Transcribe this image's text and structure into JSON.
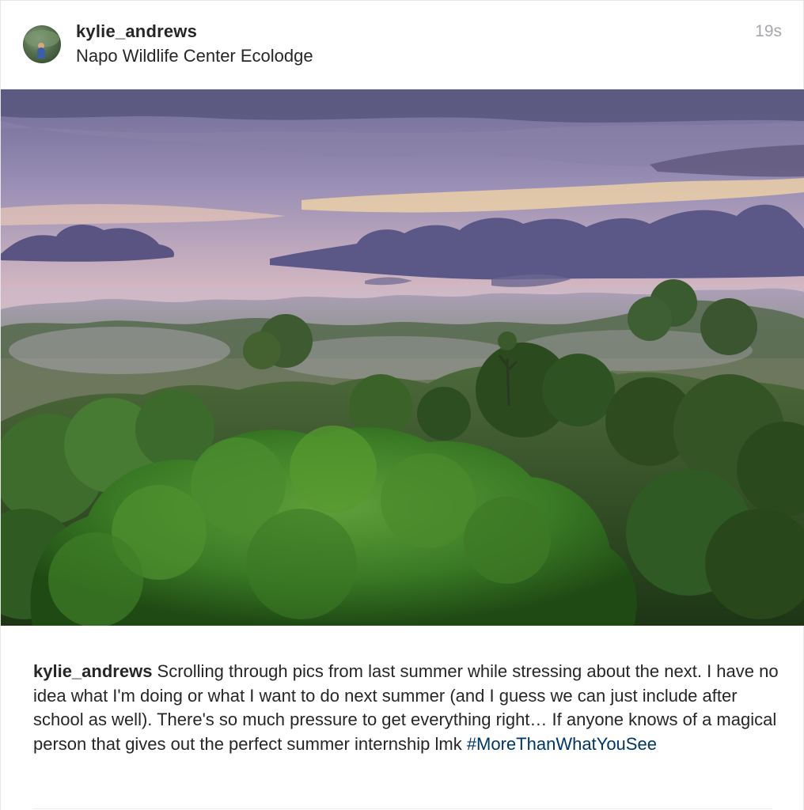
{
  "post": {
    "username": "kylie_andrews",
    "location": "Napo Wildlife Center Ecolodge",
    "timestamp": "19s",
    "avatar_icon": "profile-avatar",
    "photo_icon": "rainforest-sunset-photo",
    "caption": {
      "username": "kylie_andrews",
      "text": " Scrolling through pics from last summer while stressing about the next. I have no idea what I'm doing or what I want to do next summer (and I guess we can just include after school as well). There's so much pressure to get everything right… If anyone knows of a magical person that gives out the perfect summer internship lmk ",
      "hashtag": "#MoreThanWhatYouSee"
    }
  },
  "colors": {
    "text": "#262626",
    "timestamp": "#a5a7aa",
    "hashtag": "#003569",
    "divider": "#efefef"
  }
}
